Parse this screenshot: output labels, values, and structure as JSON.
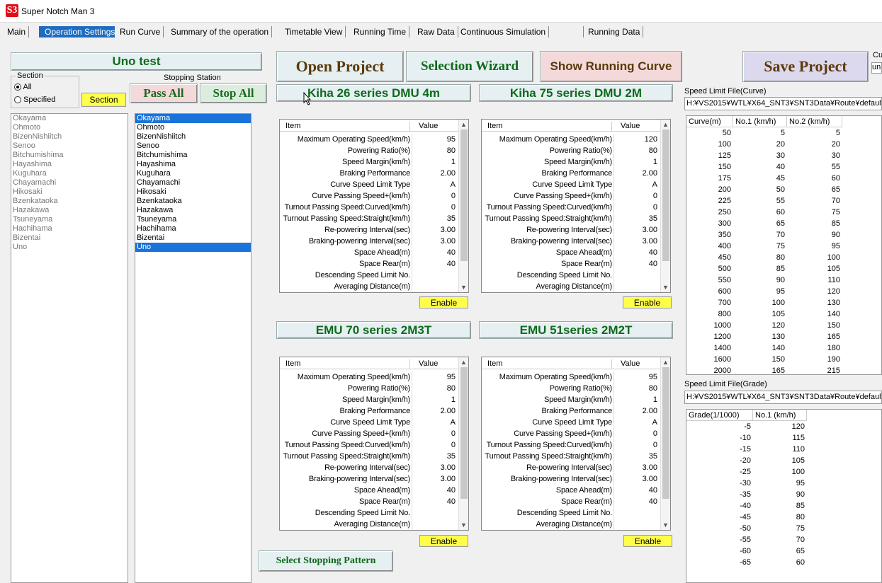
{
  "window": {
    "title": "Super Notch Man 3",
    "icon": "S3"
  },
  "tabs": [
    "Main",
    "Operation Settings",
    "Run Curve",
    "Summary of the operation",
    "Timetable View",
    "Running Time",
    "Raw Data",
    "Continuous Simulation",
    "",
    "Running Data"
  ],
  "active_tab": "Operation Settings",
  "project_name": "Uno test",
  "section": {
    "label": "Section",
    "options": [
      "All",
      "Specified"
    ],
    "selected": "All",
    "button": "Section"
  },
  "stopping_station": {
    "label": "Stopping Station",
    "pass_all": "Pass All",
    "stop_all": "Stop All"
  },
  "stations": [
    "Okayama",
    "Ohmoto",
    "BizenNishiitch",
    "Senoo",
    "Bitchumishima",
    "Hayashima",
    "Kuguhara",
    "Chayamachi",
    "Hikosaki",
    "Bzenkataoka",
    "Hazakawa",
    "Tsuneyama",
    "Hachihama",
    "Bizentai",
    "Uno"
  ],
  "selected_stations": [
    "Okayama",
    "Uno"
  ],
  "buttons": {
    "open_project": "Open Project",
    "selection_wizard": "Selection Wizard",
    "show_running_curve": "Show Running Curve",
    "save_project": "Save Project",
    "select_stopping_pattern": "Select Stopping Pattern"
  },
  "top_right_stub": {
    "label": "Cu",
    "value": "un"
  },
  "panel_headers": {
    "item": "Item",
    "value": "Value"
  },
  "param_labels": [
    "Maximum Operating Speed(km/h)",
    "Powering Ratio(%)",
    "Speed Margin(km/h)",
    "Braking Performance",
    "Curve Speed Limit Type",
    "Curve Passing Speed+(km/h)",
    "Turnout Passing Speed:Curved(km/h)",
    "Turnout Passing Speed:Straight(km/h)",
    "Re-powering Interval(sec)",
    "Braking-powering Interval(sec)",
    "Space Ahead(m)",
    "Space Rear(m)",
    "Descending Speed Limit No.",
    "Averaging Distance(m)"
  ],
  "trains": [
    {
      "name": "Kiha 26 series DMU 4m",
      "enable": "Enable",
      "values": [
        "95",
        "80",
        "1",
        "2.00",
        "A",
        "0",
        "0",
        "35",
        "3.00",
        "3.00",
        "40",
        "40",
        "",
        ""
      ]
    },
    {
      "name": "Kiha 75 series DMU  2M",
      "enable": "Enable",
      "values": [
        "120",
        "80",
        "1",
        "2.00",
        "A",
        "0",
        "0",
        "35",
        "3.00",
        "3.00",
        "40",
        "40",
        "",
        ""
      ]
    },
    {
      "name": "EMU 70 series  2M3T",
      "enable": "Enable",
      "values": [
        "95",
        "80",
        "1",
        "2.00",
        "A",
        "0",
        "0",
        "35",
        "3.00",
        "3.00",
        "40",
        "40",
        "",
        ""
      ]
    },
    {
      "name": "EMU 51series  2M2T",
      "enable": "Enable",
      "values": [
        "95",
        "80",
        "1",
        "2.00",
        "A",
        "0",
        "0",
        "35",
        "3.00",
        "3.00",
        "40",
        "40",
        "",
        ""
      ]
    }
  ],
  "curve_limit": {
    "label": "Speed Limit File(Curve)",
    "path": "H:¥VS2015¥WTL¥X64_SNT3¥SNT3Data¥Route¥default.",
    "headers": [
      "Curve(m)",
      "No.1 (km/h)",
      "No.2 (km/h)"
    ],
    "rows": [
      [
        "50",
        "5",
        "5"
      ],
      [
        "100",
        "20",
        "20"
      ],
      [
        "125",
        "30",
        "30"
      ],
      [
        "150",
        "40",
        "55"
      ],
      [
        "175",
        "45",
        "60"
      ],
      [
        "200",
        "50",
        "65"
      ],
      [
        "225",
        "55",
        "70"
      ],
      [
        "250",
        "60",
        "75"
      ],
      [
        "300",
        "65",
        "85"
      ],
      [
        "350",
        "70",
        "90"
      ],
      [
        "400",
        "75",
        "95"
      ],
      [
        "450",
        "80",
        "100"
      ],
      [
        "500",
        "85",
        "105"
      ],
      [
        "550",
        "90",
        "110"
      ],
      [
        "600",
        "95",
        "120"
      ],
      [
        "700",
        "100",
        "130"
      ],
      [
        "800",
        "105",
        "140"
      ],
      [
        "1000",
        "120",
        "150"
      ],
      [
        "1200",
        "130",
        "165"
      ],
      [
        "1400",
        "140",
        "180"
      ],
      [
        "1600",
        "150",
        "190"
      ],
      [
        "2000",
        "165",
        "215"
      ]
    ]
  },
  "grade_limit": {
    "label": "Speed Limit File(Grade)",
    "path": "H:¥VS2015¥WTL¥X64_SNT3¥SNT3Data¥Route¥default.",
    "headers": [
      "Grade(1/1000)",
      "No.1 (km/h)"
    ],
    "rows": [
      [
        "-5",
        "120"
      ],
      [
        "-10",
        "115"
      ],
      [
        "-15",
        "110"
      ],
      [
        "-20",
        "105"
      ],
      [
        "-25",
        "100"
      ],
      [
        "-30",
        "95"
      ],
      [
        "-35",
        "90"
      ],
      [
        "-40",
        "85"
      ],
      [
        "-45",
        "80"
      ],
      [
        "-50",
        "75"
      ],
      [
        "-55",
        "70"
      ],
      [
        "-60",
        "65"
      ],
      [
        "-65",
        "60"
      ]
    ]
  },
  "colors": {
    "accent": "#1e6cbf",
    "yellow": "#ffff4a",
    "green_text": "#0d6a1a",
    "brown_text": "#5a3a0a",
    "pink_btn": "#f3d9d9"
  }
}
